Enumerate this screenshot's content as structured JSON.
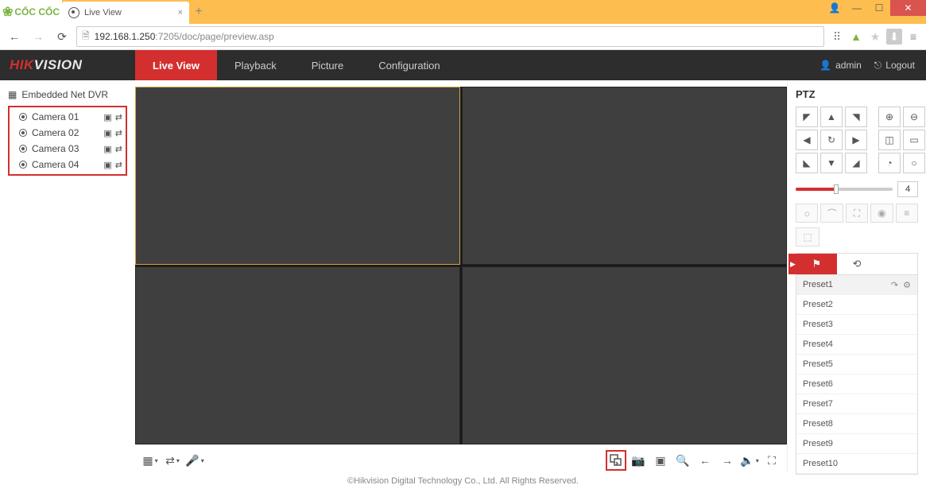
{
  "browser": {
    "logo_text": "CỐC CỐC",
    "tab_title": "Live View",
    "url_host": "192.168.1.250",
    "url_rest": ":7205/doc/page/preview.asp"
  },
  "header": {
    "brand_a": "HIK",
    "brand_b": "VISION",
    "nav": [
      "Live View",
      "Playback",
      "Picture",
      "Configuration"
    ],
    "active_nav": 0,
    "user": "admin",
    "logout": "Logout"
  },
  "sidebar": {
    "device": "Embedded Net DVR",
    "cameras": [
      "Camera 01",
      "Camera 02",
      "Camera 03",
      "Camera 04"
    ]
  },
  "ptz": {
    "title": "PTZ",
    "speed": 4,
    "presets": [
      "Preset1",
      "Preset2",
      "Preset3",
      "Preset4",
      "Preset5",
      "Preset6",
      "Preset7",
      "Preset8",
      "Preset9",
      "Preset10"
    ]
  },
  "footer": "©Hikvision Digital Technology Co., Ltd. All Rights Reserved."
}
